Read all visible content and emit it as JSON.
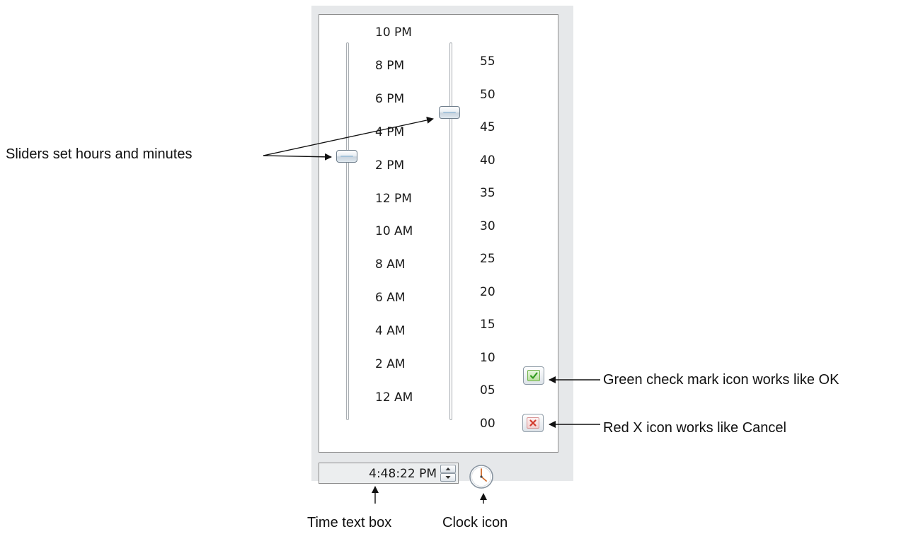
{
  "hour_ticks": [
    "10 PM",
    "8 PM",
    "6 PM",
    "4 PM",
    "2 PM",
    "12 PM",
    "10 AM",
    "8 AM",
    "6 AM",
    "4 AM",
    "2 AM",
    "12 AM"
  ],
  "minute_ticks": [
    "55",
    "50",
    "45",
    "40",
    "35",
    "30",
    "25",
    "20",
    "15",
    "10",
    "05",
    "00"
  ],
  "time_text": "4:48:22 PM",
  "icons": {
    "ok": "green-check-mark-icon",
    "cancel": "red-x-icon",
    "clock": "clock-icon",
    "spin_up": "spin-up-arrow-icon",
    "spin_down": "spin-down-arrow-icon"
  },
  "callouts": {
    "sliders": "Sliders set hours and minutes",
    "ok": "Green check mark icon works like OK",
    "cancel": "Red X icon works like Cancel",
    "time_box": "Time text box",
    "clock": "Clock icon"
  },
  "colors": {
    "check": "#2f9a1e",
    "x": "#d2382b",
    "thumb_border": "#6f7e8c",
    "panel": "#e6e8ea"
  }
}
